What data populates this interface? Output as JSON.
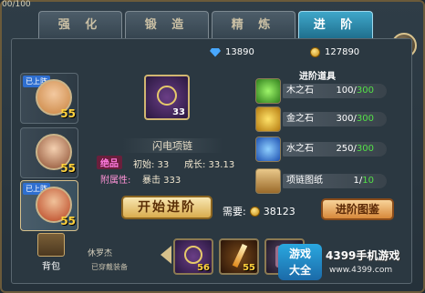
{
  "hud": {
    "stat": "00/100"
  },
  "tabs": [
    "强 化",
    "锻 造",
    "精 炼",
    "进 阶"
  ],
  "currency": {
    "gems": "13890",
    "coins": "127890"
  },
  "heroes": [
    {
      "tag": "已上阵",
      "level": "55"
    },
    {
      "tag": "",
      "level": "55"
    },
    {
      "tag": "已上阵",
      "level": "55"
    }
  ],
  "bag_label": "背包",
  "equipment": {
    "count": "33",
    "name": "闪电项链",
    "quality": "绝品",
    "initial": "初始: 33",
    "growth": "成长: 33.13",
    "extra_label": "附属性:",
    "extra_value": "暴击 333"
  },
  "materials_title": "进阶道具",
  "materials": [
    {
      "icon": "green-crystal-icon",
      "name": "木之石",
      "have": "100",
      "need": "300"
    },
    {
      "icon": "gold-crystal-icon",
      "name": "金之石",
      "have": "300",
      "need": "300"
    },
    {
      "icon": "blue-crystal-icon",
      "name": "水之石",
      "have": "250",
      "need": "300"
    },
    {
      "icon": "scroll-icon",
      "name": "项链图纸",
      "have": "1",
      "need": "10"
    }
  ],
  "actions": {
    "start": "开始进阶",
    "need_label": "需要:",
    "need_cost": "38123",
    "gallery": "进阶图鉴"
  },
  "footer": {
    "hero_name": "休罗杰",
    "equip_status": "已穿戴装备",
    "slots": [
      {
        "icon": "necklace-icon",
        "level": "56"
      },
      {
        "icon": "sword-icon",
        "level": "55"
      },
      {
        "icon": "armor-icon",
        "level": ""
      }
    ]
  },
  "watermark": {
    "logo": "游戏\n大全",
    "name": "4399手机游戏",
    "url": "www.4399.com"
  }
}
